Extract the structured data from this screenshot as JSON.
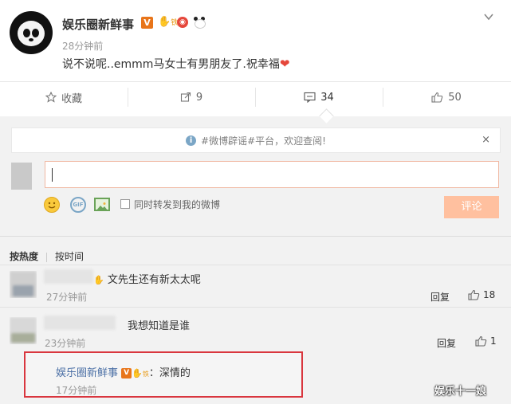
{
  "post": {
    "author": "娱乐圈新鲜事",
    "v_badge": "V",
    "fan_badge": "铁",
    "time": "28分钟前",
    "text": "说不说呢..emmm马女士有男朋友了.祝幸福",
    "heart": "❤"
  },
  "actions": {
    "favorite": "收藏",
    "repost_count": "9",
    "comment_count": "34",
    "like_count": "50"
  },
  "notice": {
    "text": "#微博辟谣#平台，欢迎查阅!",
    "close": "×"
  },
  "composer": {
    "sync_label": "同时转发到我的微博",
    "submit_label": "评论",
    "gif_label": "GIF"
  },
  "sort": {
    "hot": "按热度",
    "time": "按时间"
  },
  "comments": [
    {
      "text": "文先生还有新太太呢",
      "time": "27分钟前",
      "reply_label": "回复",
      "likes": "18"
    },
    {
      "text": "我想知道是谁",
      "time": "23分钟前",
      "reply_label": "回复",
      "likes": "1"
    }
  ],
  "sub_reply": {
    "author": "娱乐圈新鲜事",
    "v_badge": "V",
    "fan_badge": "铁",
    "text": "深情的",
    "time": "17分钟前"
  },
  "watermark": "娱乐十一娘",
  "colors": {
    "accent_orange": "#e8751a",
    "submit_bg": "#ffc09f",
    "highlight_border": "#d9363e",
    "link_blue": "#4a6fa5"
  }
}
